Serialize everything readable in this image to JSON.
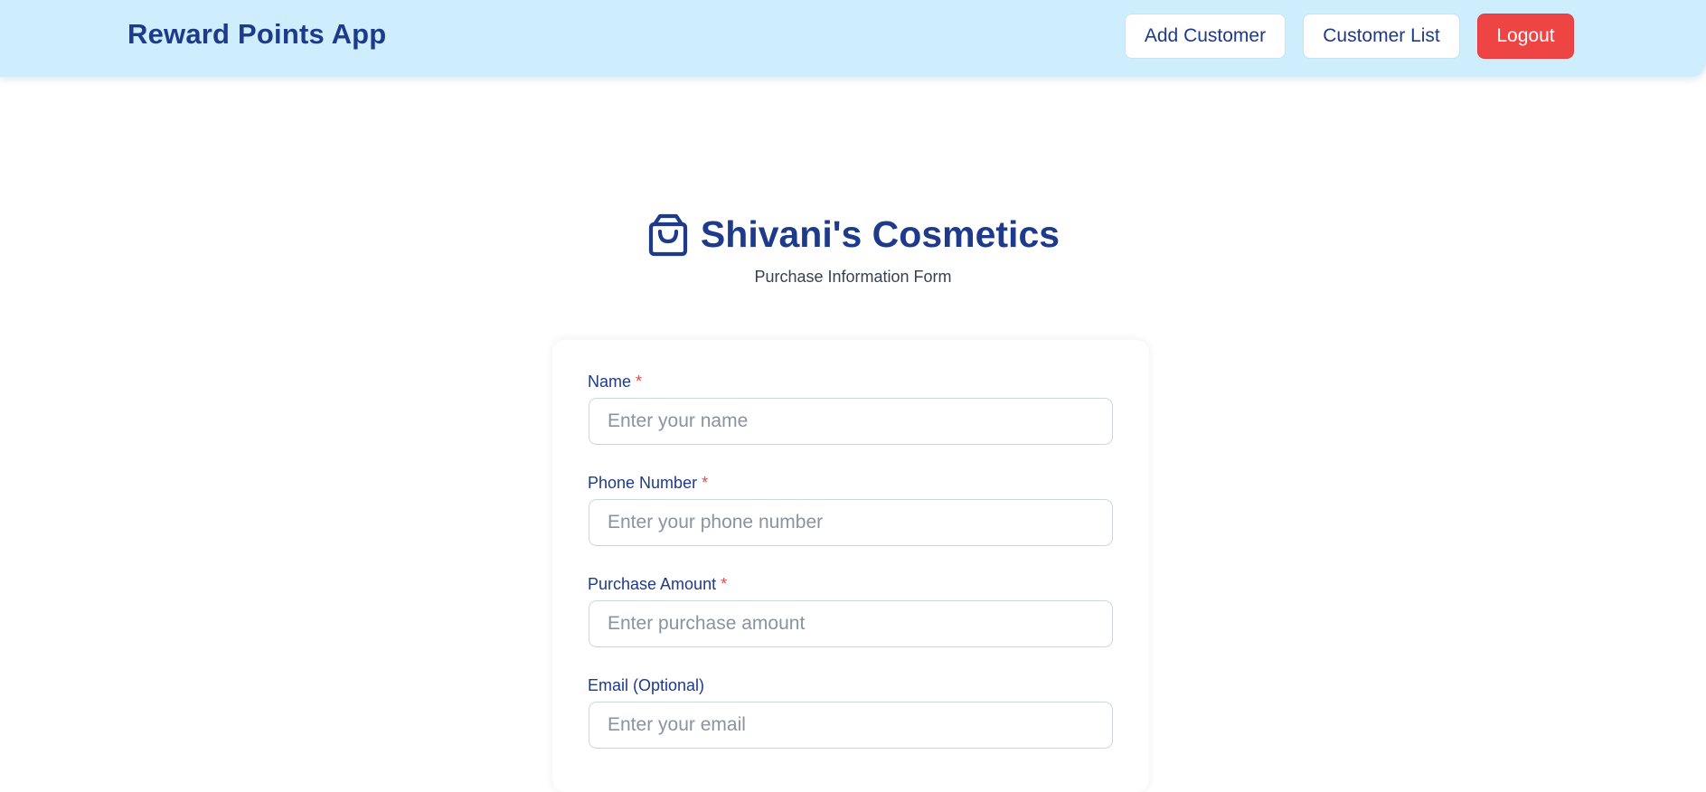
{
  "app": {
    "brand": "Reward Points App"
  },
  "nav": {
    "add_customer": "Add Customer",
    "customer_list": "Customer List",
    "logout": "Logout"
  },
  "page": {
    "title": "Shivani's Cosmetics",
    "subtitle": "Purchase Information Form",
    "title_icon": "shopping-bag-icon"
  },
  "form": {
    "required_marker": "*",
    "name": {
      "label": "Name",
      "placeholder": "Enter your name",
      "value": ""
    },
    "phone": {
      "label": "Phone Number",
      "placeholder": "Enter your phone number",
      "value": ""
    },
    "amount": {
      "label": "Purchase Amount",
      "placeholder": "Enter purchase amount",
      "value": ""
    },
    "email": {
      "label": "Email (Optional)",
      "placeholder": "Enter your email",
      "value": ""
    }
  },
  "colors": {
    "header_background": "#cfeefd",
    "brand_text": "#1e3a8a",
    "logout_button": "#ef4444",
    "required_marker": "#ef4444"
  }
}
